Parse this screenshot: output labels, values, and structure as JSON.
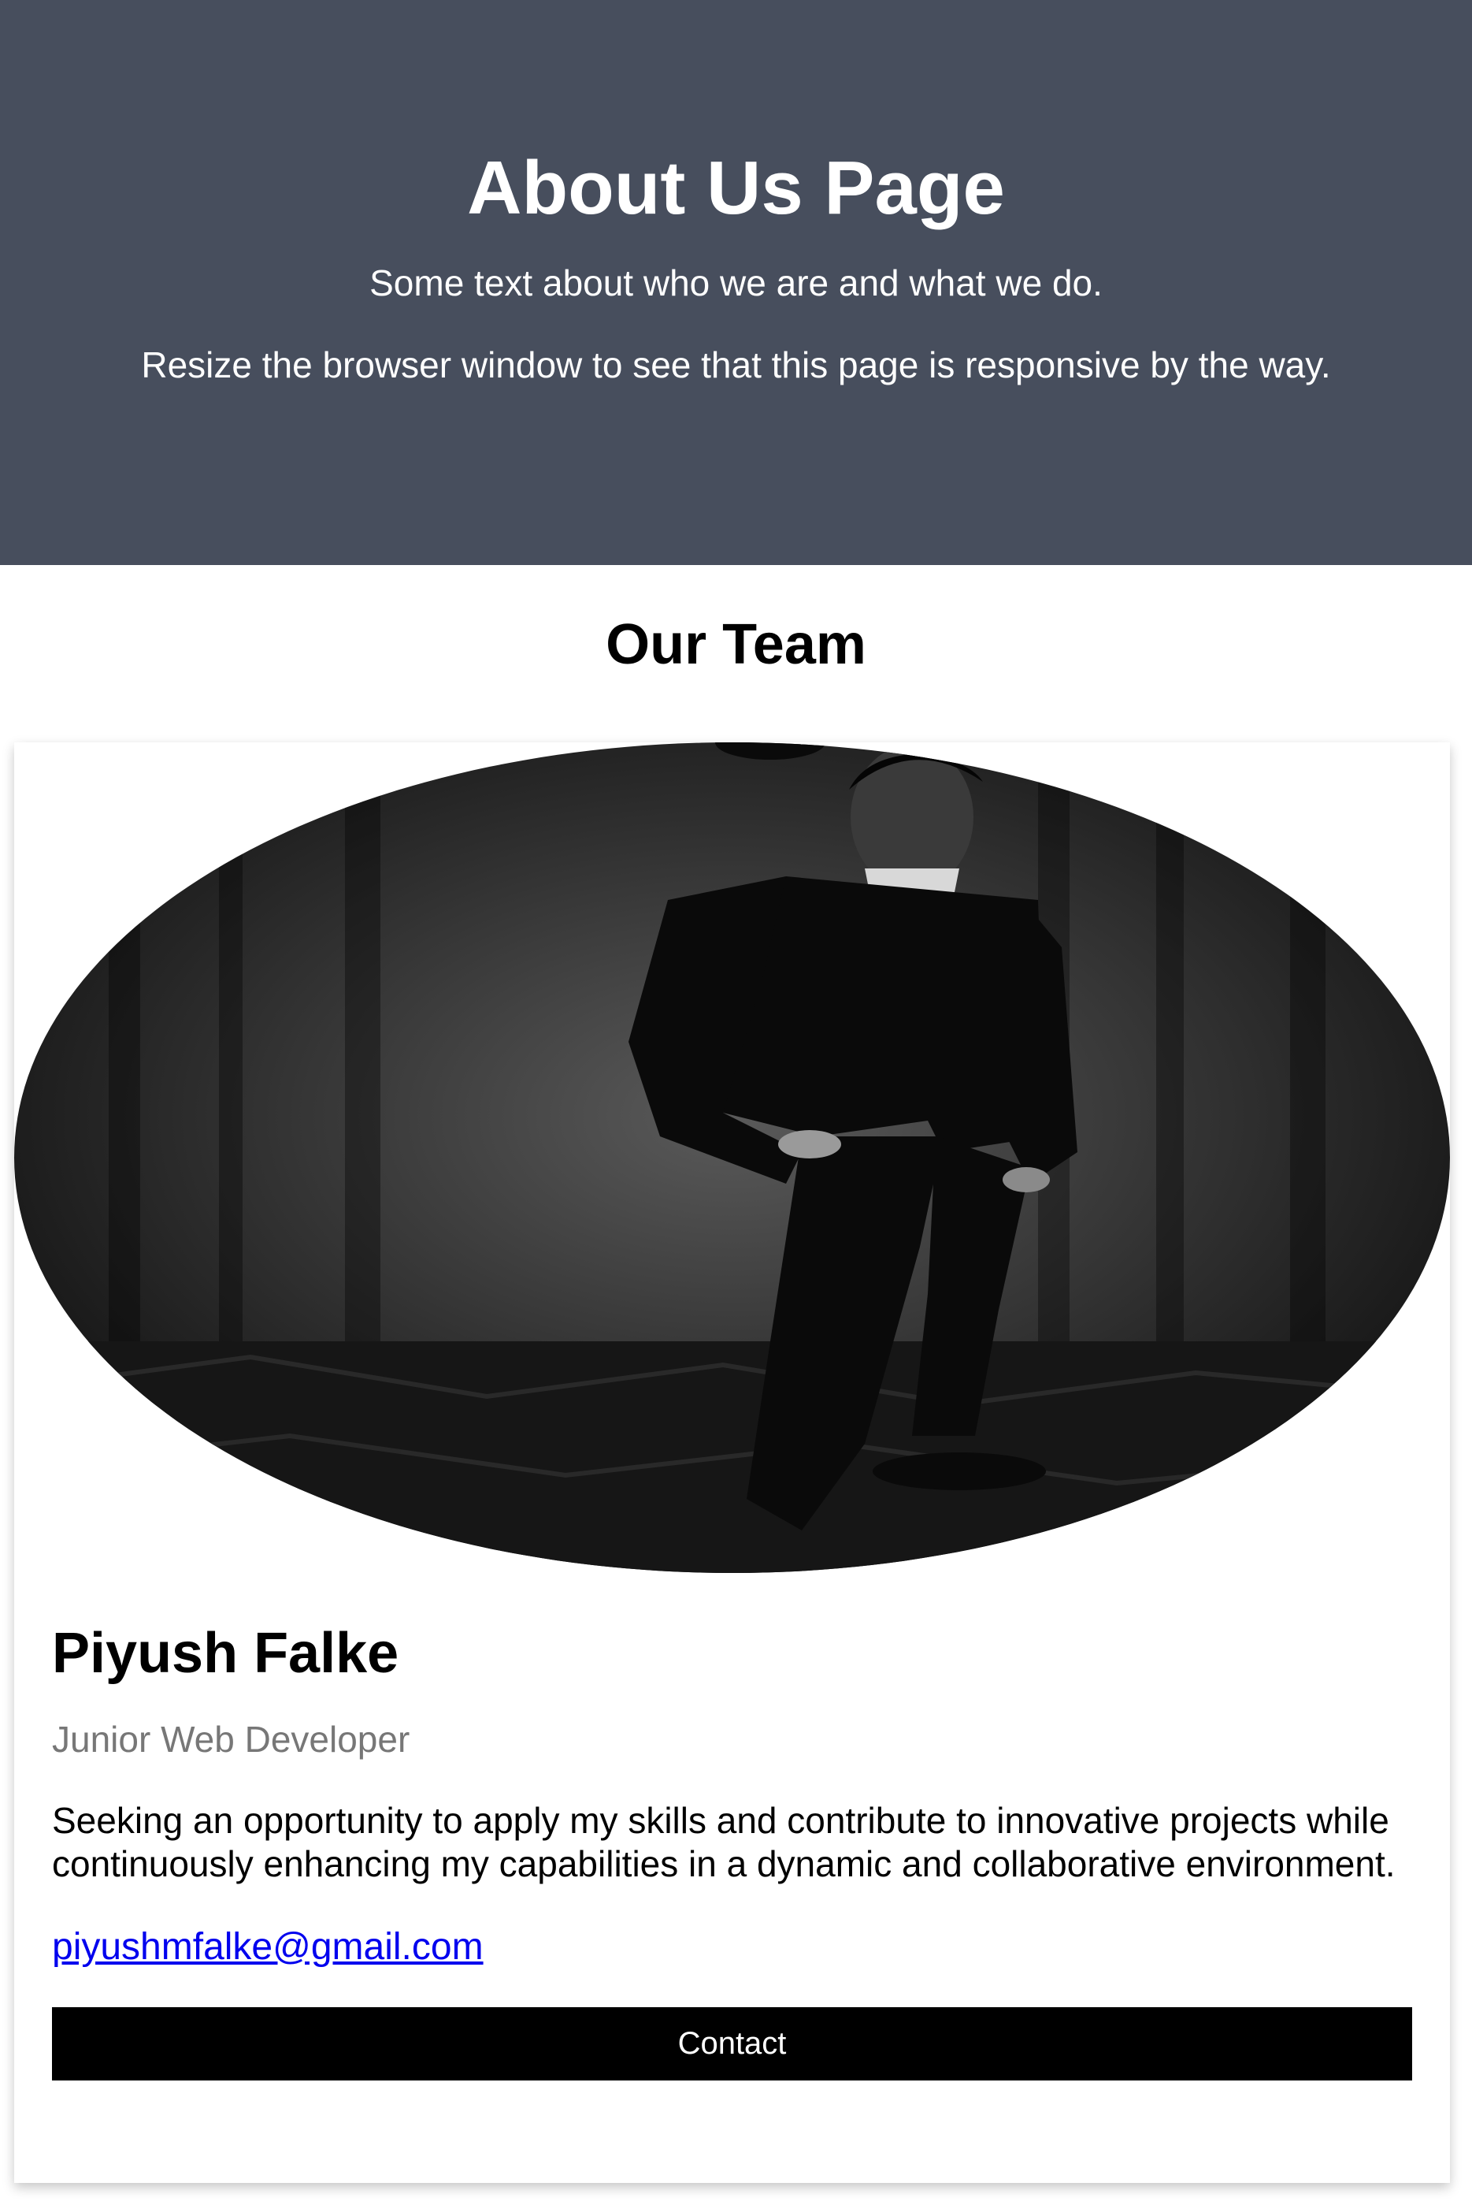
{
  "hero": {
    "title": "About Us Page",
    "line1": "Some text about who we are and what we do.",
    "line2": "Resize the browser window to see that this page is responsive by the way.",
    "background": "#474e5d"
  },
  "team": {
    "heading": "Our Team",
    "members": [
      {
        "photo_icon": "person-in-suit-photo",
        "name": "Piyush Falke",
        "role": "Junior Web Developer",
        "description": "Seeking an opportunity to apply my skills and contribute to innovative projects while continuously enhancing my capabilities in a dynamic and collaborative environment.",
        "email": "piyushmfalke@gmail.com",
        "button_label": "Contact"
      }
    ]
  },
  "colors": {
    "button_bg": "#000000",
    "link": "#0000ee",
    "role_text": "#777777"
  }
}
